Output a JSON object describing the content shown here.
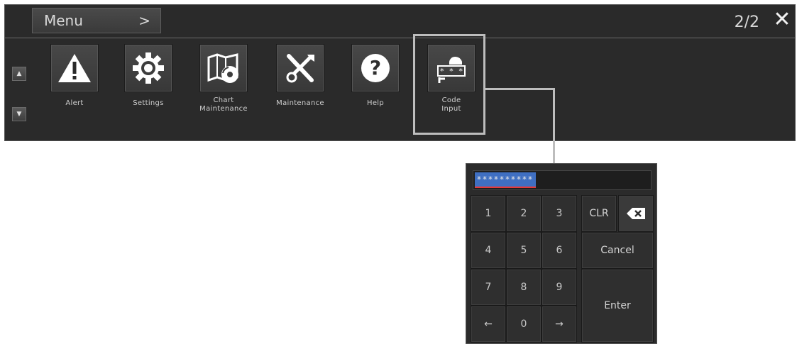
{
  "menu": {
    "title": "Menu",
    "chevron": ">",
    "page_indicator": "2/2",
    "close_icon": "close-icon",
    "items": [
      {
        "label": "Alert",
        "icon": "alert-icon"
      },
      {
        "label": "Settings",
        "icon": "gear-icon"
      },
      {
        "label": "Chart\nMaintenance",
        "icon": "chart-maintenance-icon"
      },
      {
        "label": "Maintenance",
        "icon": "tools-icon"
      },
      {
        "label": "Help",
        "icon": "help-icon"
      },
      {
        "label": "Code\nInput",
        "icon": "code-input-icon"
      }
    ]
  },
  "keypad": {
    "code_value": "**********",
    "keys": {
      "k1": "1",
      "k2": "2",
      "k3": "3",
      "k4": "4",
      "k5": "5",
      "k6": "6",
      "k7": "7",
      "k8": "8",
      "k9": "9",
      "left": "←",
      "k0": "0",
      "right": "→",
      "clr": "CLR",
      "cancel": "Cancel",
      "enter": "Enter"
    }
  },
  "colors": {
    "panel_bg": "#2a2a2a",
    "highlight": "#bdbdbd",
    "code_selection": "#3f6fc2",
    "underline": "#e43a3a"
  }
}
